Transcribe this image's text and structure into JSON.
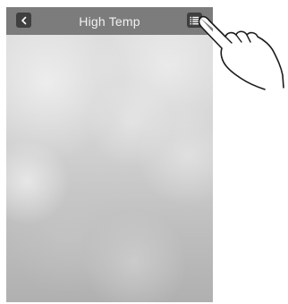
{
  "header": {
    "title": "High Temp",
    "back_icon": "chevron-left-icon",
    "menu_icon": "list-icon"
  },
  "pointer_icon": "hand-pointer-icon",
  "colors": {
    "header_bg": "#7c7c7c",
    "button_bg": "#3f3f3f",
    "title_text": "#f2f2f2"
  }
}
